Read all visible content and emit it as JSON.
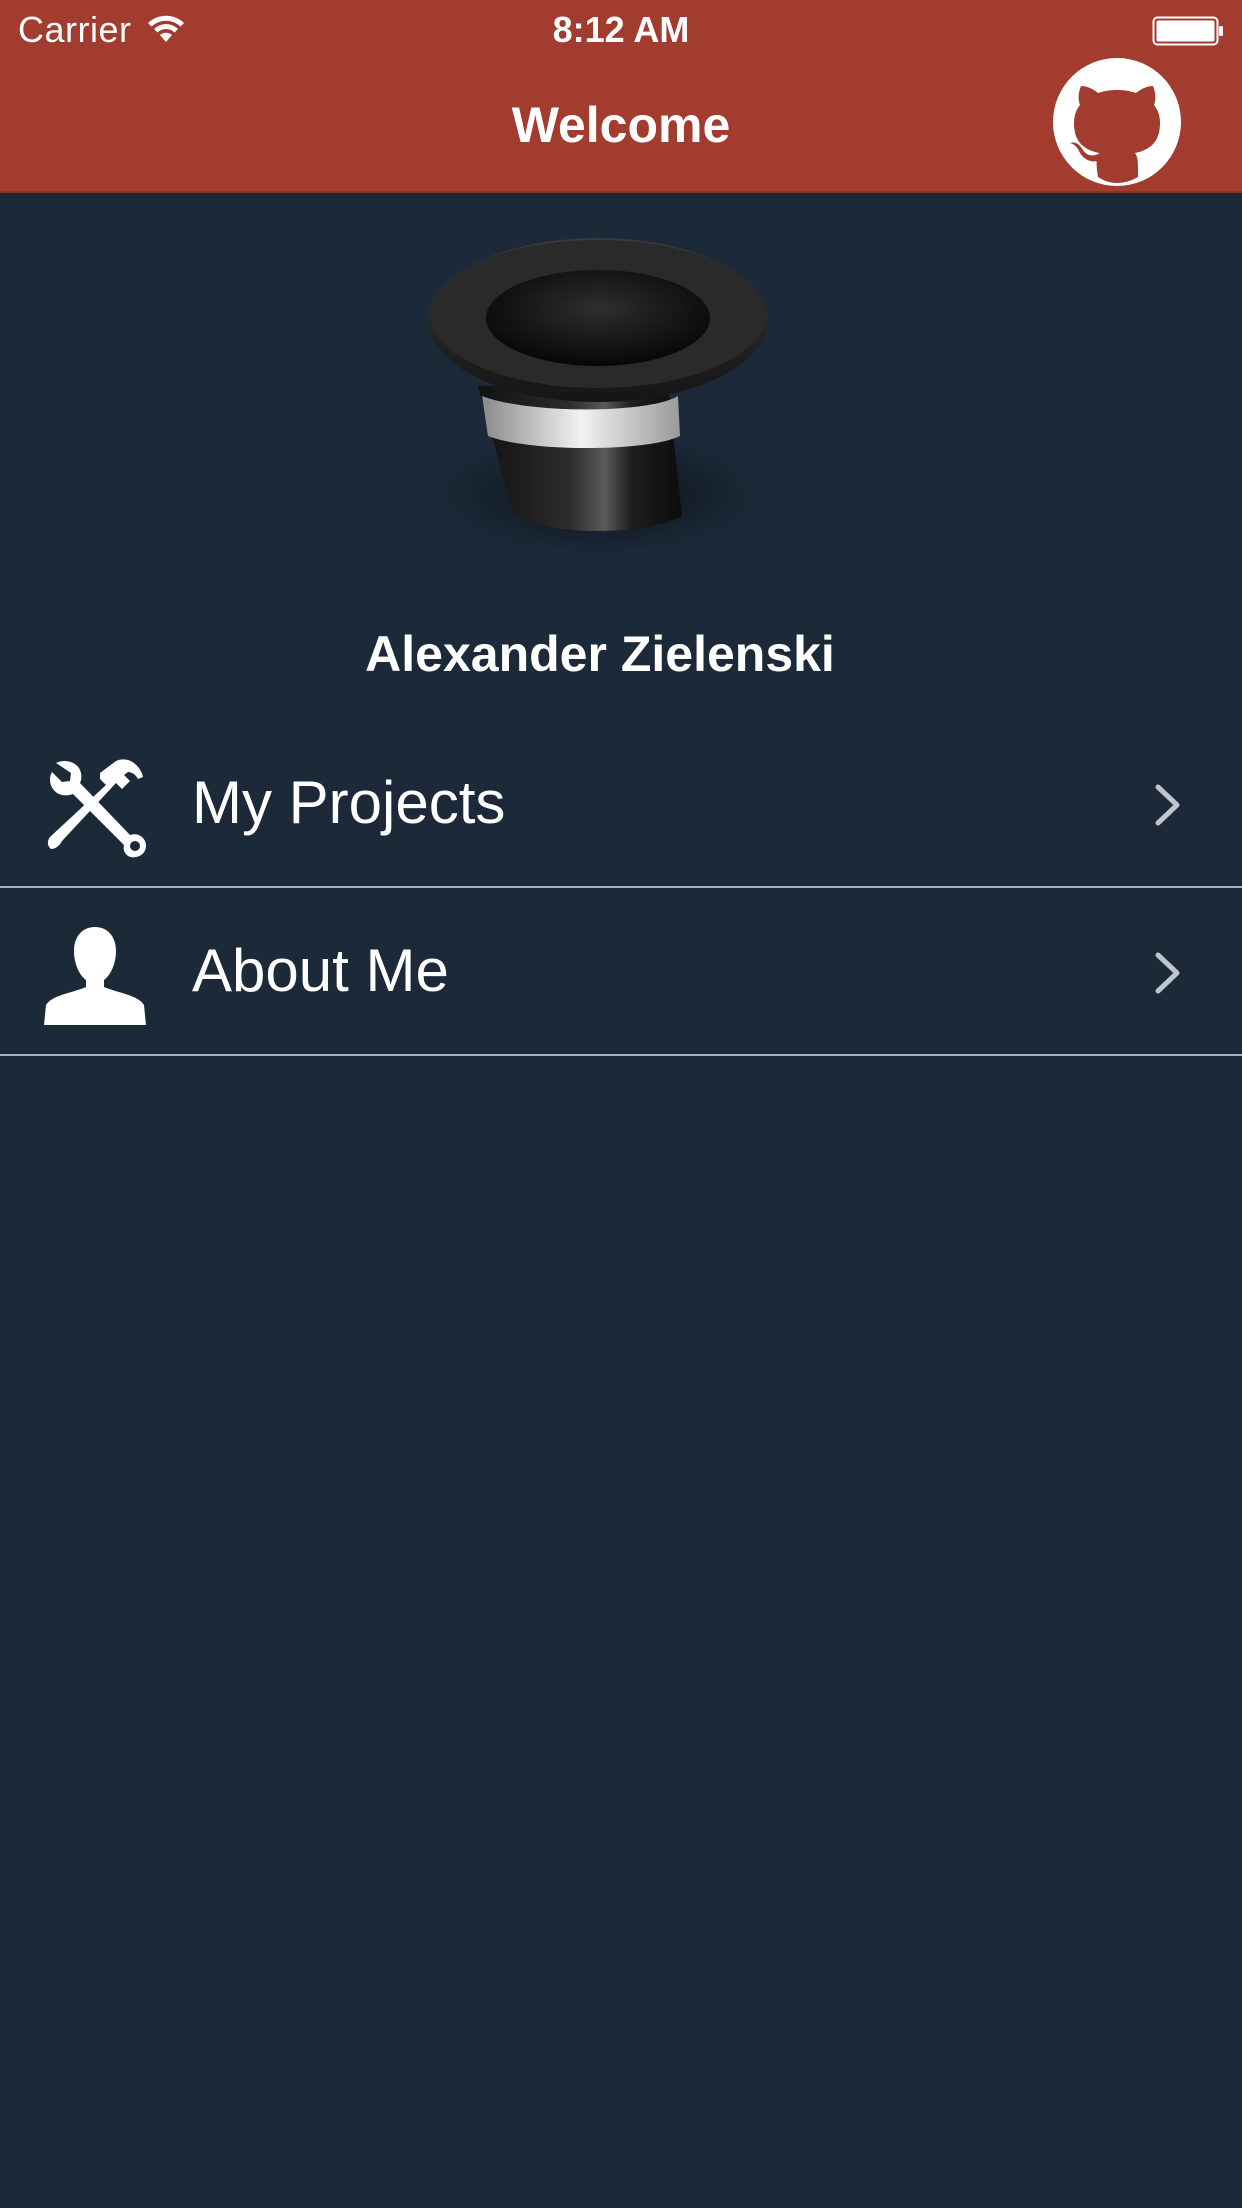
{
  "status_bar": {
    "carrier": "Carrier",
    "time": "8:12 AM",
    "wifi_icon": "wifi-icon",
    "battery_icon": "battery-full-icon"
  },
  "nav": {
    "title": "Welcome",
    "github_icon": "github-icon"
  },
  "profile": {
    "image_icon": "top-hat-icon",
    "name": "Alexander Zielenski"
  },
  "menu": {
    "items": [
      {
        "label": "My Projects",
        "icon": "tools-icon"
      },
      {
        "label": "About Me",
        "icon": "person-icon"
      }
    ]
  },
  "colors": {
    "header": "#a23c2e",
    "background": "#1b2938",
    "separator": "#a8b0b8",
    "text": "#ffffff",
    "chevron": "#c0c6cc"
  }
}
